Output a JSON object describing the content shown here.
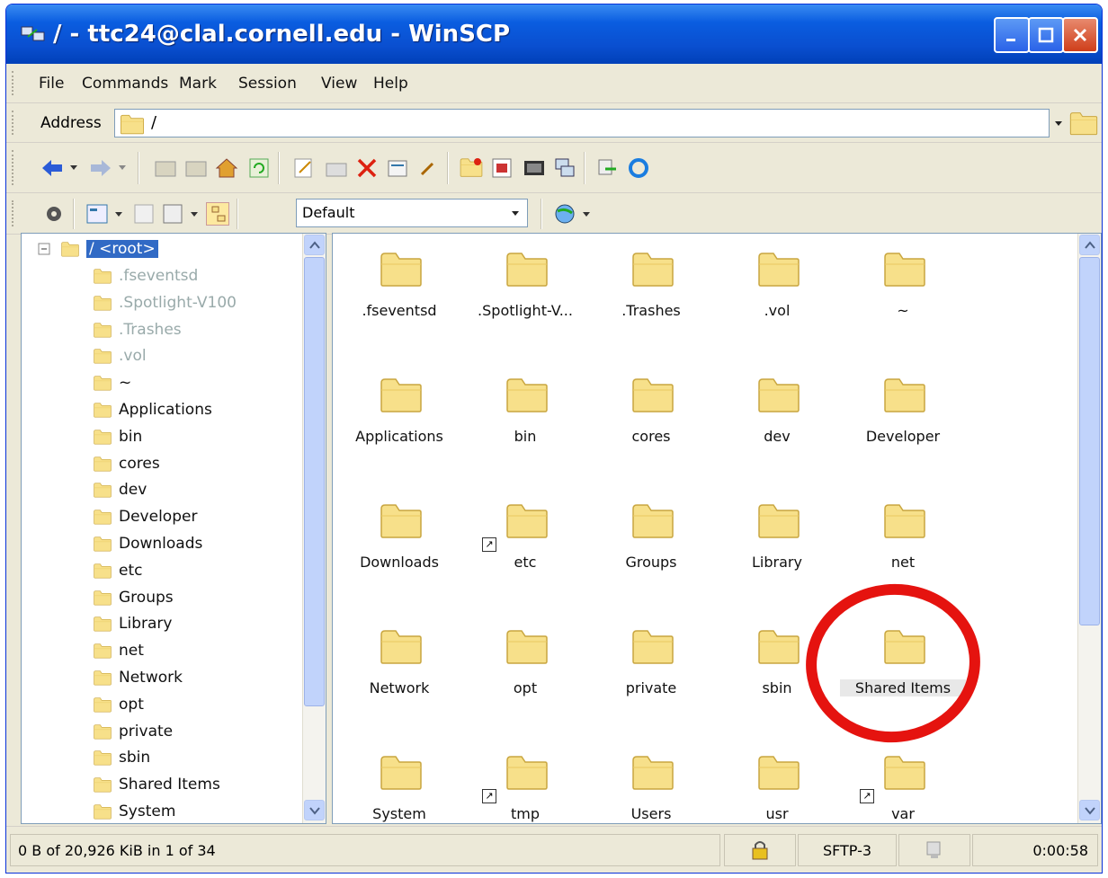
{
  "window": {
    "title": "/ - ttc24@clal.cornell.edu - WinSCP"
  },
  "menu": [
    "File",
    "Commands",
    "Mark",
    "Session",
    "View",
    "Help"
  ],
  "address": {
    "label": "Address",
    "value": "/"
  },
  "toolbar2": {
    "filter_value": "Default"
  },
  "tree": {
    "root": "/ <root>",
    "items": [
      {
        "label": ".fseventsd",
        "dim": true
      },
      {
        "label": ".Spotlight-V100",
        "dim": true
      },
      {
        "label": ".Trashes",
        "dim": true
      },
      {
        "label": ".vol",
        "dim": true
      },
      {
        "label": "~",
        "dim": false
      },
      {
        "label": "Applications",
        "dim": false
      },
      {
        "label": "bin",
        "dim": false
      },
      {
        "label": "cores",
        "dim": false
      },
      {
        "label": "dev",
        "dim": false
      },
      {
        "label": "Developer",
        "dim": false
      },
      {
        "label": "Downloads",
        "dim": false
      },
      {
        "label": "etc",
        "dim": false
      },
      {
        "label": "Groups",
        "dim": false
      },
      {
        "label": "Library",
        "dim": false
      },
      {
        "label": "net",
        "dim": false
      },
      {
        "label": "Network",
        "dim": false
      },
      {
        "label": "opt",
        "dim": false
      },
      {
        "label": "private",
        "dim": false
      },
      {
        "label": "sbin",
        "dim": false
      },
      {
        "label": "Shared Items",
        "dim": false
      },
      {
        "label": "System",
        "dim": false
      }
    ]
  },
  "files": [
    {
      "label": ".fseventsd",
      "dim": true,
      "link": false
    },
    {
      "label": ".Spotlight-V...",
      "dim": true,
      "link": false
    },
    {
      "label": ".Trashes",
      "dim": true,
      "link": false
    },
    {
      "label": ".vol",
      "dim": true,
      "link": false
    },
    {
      "label": "~",
      "dim": false,
      "link": false
    },
    {
      "label": "Applications",
      "dim": false,
      "link": false
    },
    {
      "label": "bin",
      "dim": false,
      "link": false
    },
    {
      "label": "cores",
      "dim": false,
      "link": false
    },
    {
      "label": "dev",
      "dim": false,
      "link": false
    },
    {
      "label": "Developer",
      "dim": false,
      "link": false
    },
    {
      "label": "Downloads",
      "dim": false,
      "link": false
    },
    {
      "label": "etc",
      "dim": false,
      "link": true
    },
    {
      "label": "Groups",
      "dim": false,
      "link": false
    },
    {
      "label": "Library",
      "dim": false,
      "link": false
    },
    {
      "label": "net",
      "dim": false,
      "link": false
    },
    {
      "label": "Network",
      "dim": false,
      "link": false
    },
    {
      "label": "opt",
      "dim": false,
      "link": false
    },
    {
      "label": "private",
      "dim": false,
      "link": false
    },
    {
      "label": "sbin",
      "dim": false,
      "link": false
    },
    {
      "label": "Shared Items",
      "dim": false,
      "link": false
    },
    {
      "label": "System",
      "dim": false,
      "link": false
    },
    {
      "label": "tmp",
      "dim": false,
      "link": true
    },
    {
      "label": "Users",
      "dim": false,
      "link": false
    },
    {
      "label": "usr",
      "dim": false,
      "link": false
    },
    {
      "label": "var",
      "dim": false,
      "link": true
    }
  ],
  "status": {
    "selection": "0 B of 20,926 KiB in 1 of 34",
    "protocol": "SFTP-3",
    "time": "0:00:58"
  },
  "colors": {
    "accent": "#0a5de0",
    "highlight": "#e5130f",
    "folder": "#f7e08a"
  }
}
